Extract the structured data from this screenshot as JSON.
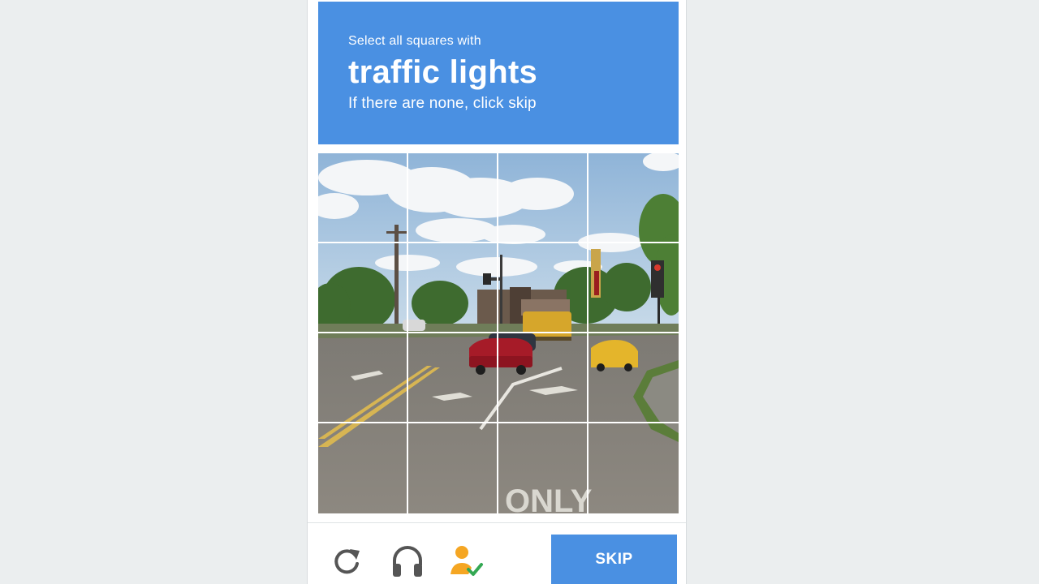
{
  "challenge": {
    "instruction": "Select all squares with",
    "target": "traffic lights",
    "hint": "If there are none, click skip"
  },
  "grid": {
    "rows": 4,
    "cols": 4
  },
  "footer": {
    "reload_icon": "reload-icon",
    "audio_icon": "headphones-icon",
    "info_icon": "person-check-icon",
    "skip_label": "SKIP"
  },
  "colors": {
    "accent": "#4a90e2",
    "background": "#ebeeef",
    "info_orange": "#f5a623",
    "check_green": "#34a853"
  }
}
